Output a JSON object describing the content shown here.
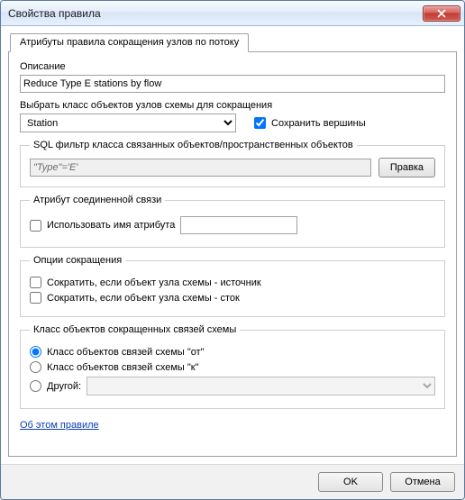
{
  "window": {
    "title": "Свойства правила"
  },
  "tab": {
    "label": "Атрибуты правила сокращения узлов по потоку"
  },
  "desc": {
    "label": "Описание",
    "value": "Reduce Type E stations by flow"
  },
  "nodeclass": {
    "label": "Выбрать класс объектов узлов схемы для сокращения",
    "value": "Station",
    "keep_vertices": "Сохранить вершины"
  },
  "sql": {
    "legend": "SQL фильтр класса связанных объектов/пространственных объектов",
    "value": "\"Type\"='E'",
    "edit_btn": "Правка"
  },
  "attr": {
    "legend": "Атрибут соединенной связи",
    "use_name": "Использовать имя атрибута",
    "value": ""
  },
  "opts": {
    "legend": "Опции сокращения",
    "source": "Сократить, если объект узла схемы - источник",
    "sink": "Сократить, если объект узла схемы - сток"
  },
  "target": {
    "legend": "Класс объектов сокращенных связей схемы",
    "from": "Класс объектов связей схемы \"от\"",
    "to": "Класс объектов связей схемы \"к\"",
    "other": "Другой:",
    "other_value": ""
  },
  "link": {
    "about": "Об этом правиле"
  },
  "buttons": {
    "ok": "OK",
    "cancel": "Отмена"
  }
}
